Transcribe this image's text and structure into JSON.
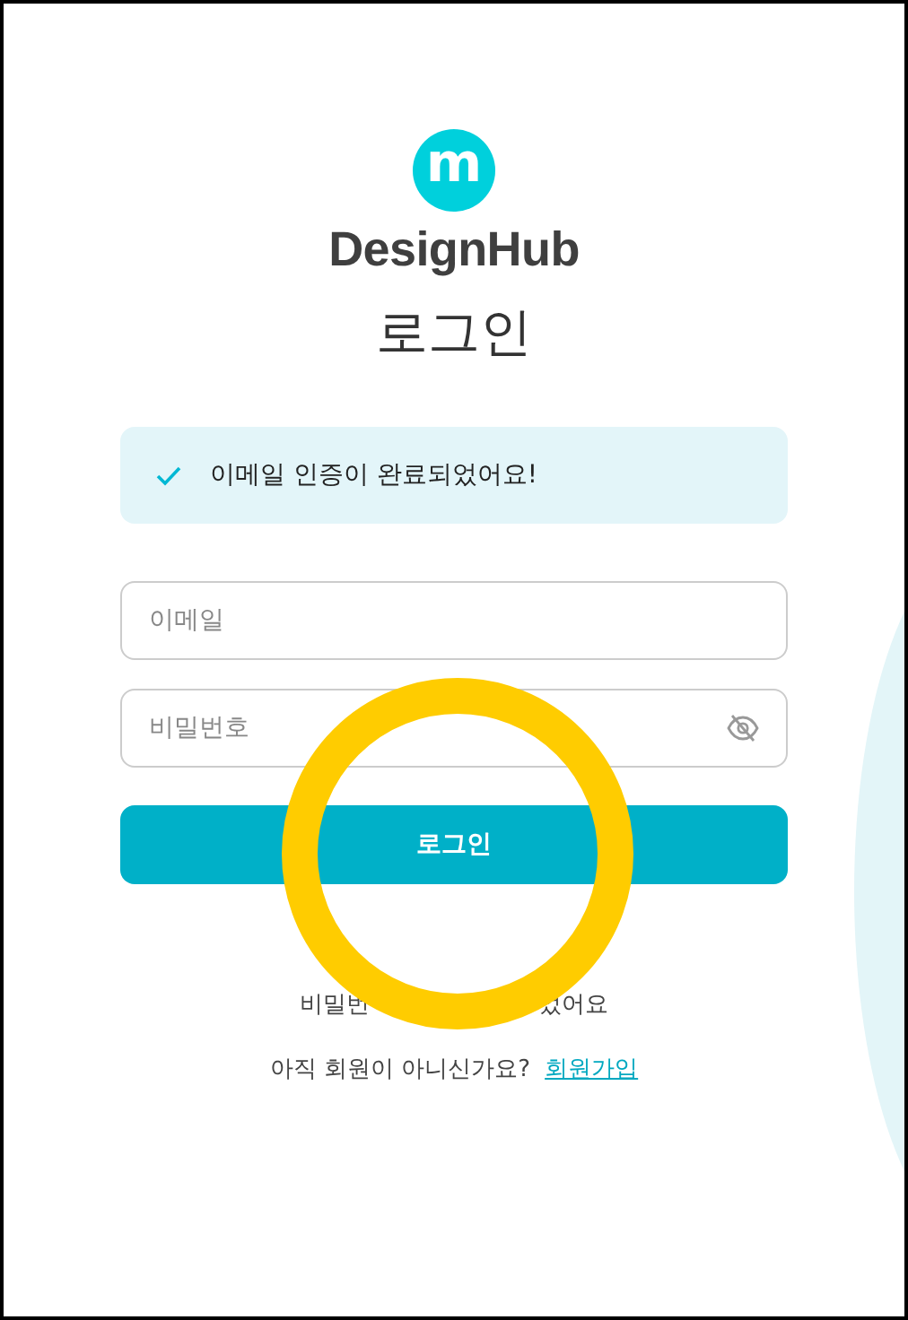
{
  "logo": {
    "mark": "m",
    "name": "DesignHub"
  },
  "title": "로그인",
  "alert": {
    "kind": "success",
    "message": "이메일 인증이 완료되었어요!"
  },
  "fields": [
    {
      "kind": "email",
      "placeholder": "이메일"
    },
    {
      "kind": "password",
      "placeholder": "비밀번호",
      "password_visible": false
    }
  ],
  "submit": "로그인",
  "forgot_link_parts": [
    "비밀번",
    "었어요"
  ],
  "signup": {
    "question": "아직 회원이 아니신가요?",
    "link": "회원가입"
  }
}
